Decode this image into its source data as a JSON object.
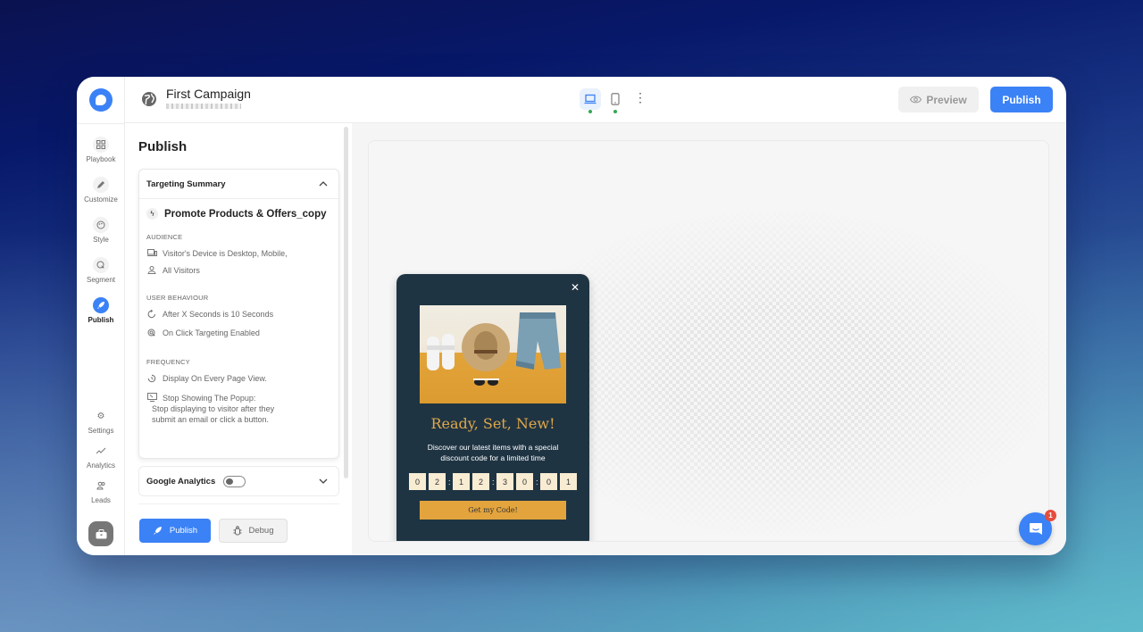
{
  "header": {
    "campaign_title": "First Campaign",
    "devices": [
      {
        "name": "desktop",
        "active": true,
        "status": "online"
      },
      {
        "name": "mobile",
        "active": false,
        "status": "online"
      }
    ],
    "preview_label": "Preview",
    "publish_label": "Publish"
  },
  "rail": {
    "items": [
      {
        "label": "Playbook",
        "icon": "grid-icon"
      },
      {
        "label": "Customize",
        "icon": "pencil-icon"
      },
      {
        "label": "Style",
        "icon": "palette-icon"
      },
      {
        "label": "Segment",
        "icon": "target-click-icon"
      },
      {
        "label": "Publish",
        "icon": "rocket-icon",
        "active": true
      }
    ],
    "bottom_items": [
      {
        "label": "Settings",
        "icon": "gear-icon"
      },
      {
        "label": "Analytics",
        "icon": "trend-icon"
      },
      {
        "label": "Leads",
        "icon": "users-icon"
      }
    ]
  },
  "panel": {
    "title": "Publish",
    "targeting_summary": {
      "header": "Targeting Summary",
      "campaign_name": "Promote Products & Offers_copy",
      "audience": {
        "label": "AUDIENCE",
        "rows": [
          "Visitor's Device is Desktop, Mobile,",
          "All Visitors"
        ]
      },
      "user_behaviour": {
        "label": "USER BEHAVIOUR",
        "rows": [
          "After X Seconds is 10 Seconds",
          "On Click Targeting Enabled"
        ]
      },
      "frequency": {
        "label": "FREQUENCY",
        "rows": [
          "Display On Every Page View."
        ],
        "stop_title": "Stop Showing The Popup:",
        "stop_line1": "Stop displaying to visitor after they",
        "stop_line2": "submit an email or click a button."
      }
    },
    "google_analytics": {
      "label": "Google Analytics",
      "enabled": false
    },
    "publish_label": "Publish",
    "debug_label": "Debug"
  },
  "popup": {
    "title": "Ready, Set, New!",
    "description": "Discover our latest items with a special discount code for a limited time",
    "timer_digits": [
      "0",
      "2",
      "1",
      "2",
      "3",
      "0",
      "0",
      "1"
    ],
    "cta_label": "Get my Code!"
  },
  "chat": {
    "badge_count": "1"
  },
  "colors": {
    "accent": "#3b82f6",
    "popup_bg": "#1f3443",
    "popup_gold": "#e3a43d",
    "timer_box": "#f8ecd3"
  }
}
